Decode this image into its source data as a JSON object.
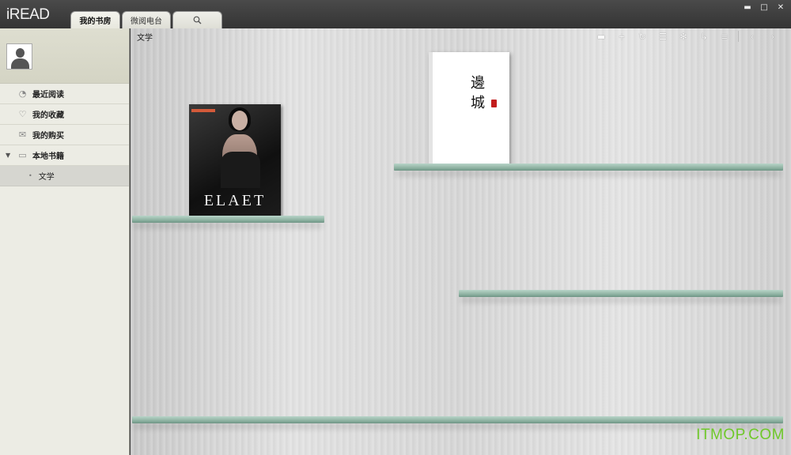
{
  "app": {
    "logo": "iREAD"
  },
  "tabs": [
    {
      "label": "我的书房",
      "active": true
    },
    {
      "label": "微阅电台",
      "active": false
    },
    {
      "label": "",
      "icon": "search-icon"
    }
  ],
  "window_controls": {
    "minimize": "▬",
    "maximize": "□",
    "close": "✕"
  },
  "sidebar": {
    "items": [
      {
        "label": "最近阅读",
        "icon": "clock-icon",
        "glyph": "◔"
      },
      {
        "label": "我的收藏",
        "icon": "heart-icon",
        "glyph": "♡"
      },
      {
        "label": "我的购买",
        "icon": "envelope-icon",
        "glyph": "✉"
      },
      {
        "label": "本地书籍",
        "icon": "folder-icon",
        "glyph": "▭",
        "caret": "▼"
      }
    ],
    "subitems": [
      {
        "label": "文学",
        "bullet": "•"
      }
    ]
  },
  "main": {
    "breadcrumb": "文学",
    "toolbar": [
      {
        "icon": "import-icon",
        "glyph": "▬"
      },
      {
        "icon": "add-icon",
        "glyph": "+"
      },
      {
        "icon": "refresh-icon",
        "glyph": "↻"
      },
      {
        "icon": "list-view-icon",
        "glyph": "☰"
      },
      {
        "icon": "settings-icon",
        "glyph": "✻"
      },
      {
        "icon": "sort-icon",
        "glyph": "↳"
      },
      {
        "icon": "menu-icon",
        "glyph": "≡"
      }
    ],
    "nav": [
      {
        "icon": "prev-icon",
        "glyph": "‹"
      },
      {
        "icon": "next-icon",
        "glyph": "›"
      }
    ],
    "books": [
      {
        "title": "ELAET"
      },
      {
        "title_line1": "邊",
        "title_line2": "城"
      }
    ]
  },
  "watermark": "ITMOP.COM",
  "colors": {
    "titlebar": "#3b3b3b",
    "sidebar": "#ecece4",
    "shelf": "#8fb3a3",
    "watermark": "#6fc82a"
  }
}
